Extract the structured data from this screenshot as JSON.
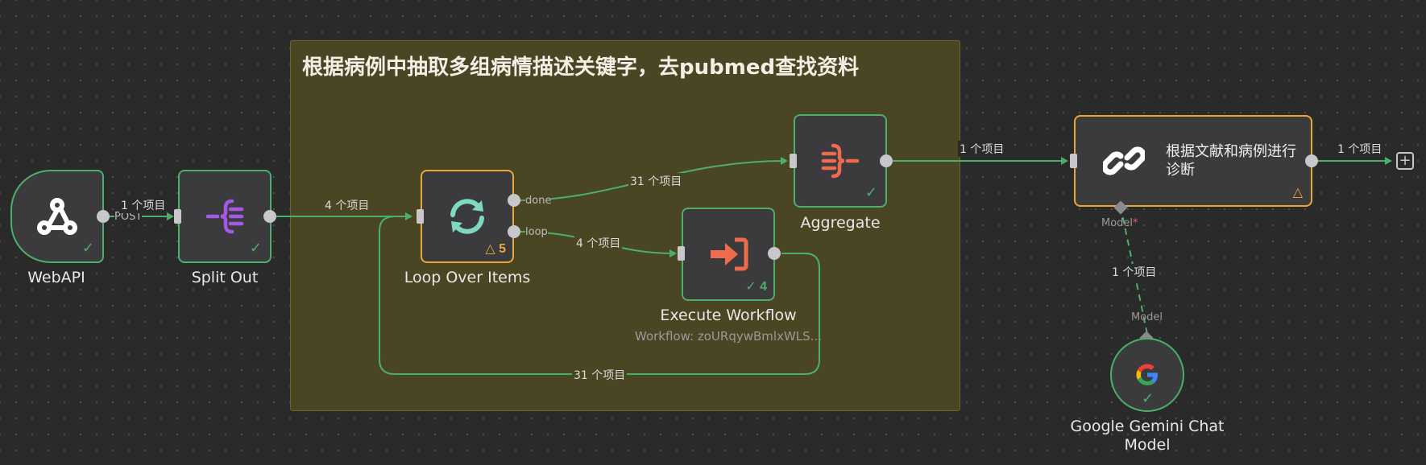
{
  "sticky_note": {
    "title": "根据病例中抽取多组病情描述关键字，去pubmed查找资料"
  },
  "nodes": {
    "webapi": {
      "label": "WebAPI",
      "output_name": "POST"
    },
    "split_out": {
      "label": "Split Out"
    },
    "loop": {
      "label": "Loop Over Items",
      "badge": "5",
      "out_done": "done",
      "out_loop": "loop"
    },
    "execute": {
      "label": "Execute Workflow",
      "subtitle": "Workflow: zoURqywBmlxWLS...",
      "badge": "4"
    },
    "aggregate": {
      "label": "Aggregate"
    },
    "diagnose": {
      "title": "根据文献和病例进行诊断",
      "model_input": "Model",
      "model_required": "*"
    },
    "gemini": {
      "label": "Google Gemini Chat Model",
      "model_output": "Model"
    }
  },
  "edges": {
    "webapi_split": "1 个项目",
    "split_loop": "4 个项目",
    "done_aggregate": "31 个项目",
    "loop_execute": "4 个项目",
    "execute_back": "31 个项目",
    "aggregate_diagnose": "1 个项目",
    "diagnose_out": "1 个项目",
    "gemini_diagnose": "1 个项目"
  },
  "colors": {
    "success": "#4caf6a",
    "warning": "#e8a838",
    "sticky_bg": "#4a4522",
    "canvas_bg": "#2a2a2b"
  },
  "icons": {
    "webapi": "webhook-icon",
    "split_out": "split-out-icon",
    "loop": "loop-arrows-icon",
    "execute": "execute-workflow-icon",
    "aggregate": "aggregate-icon",
    "diagnose": "link-chain-icon",
    "gemini": "google-g-icon",
    "add": "plus-icon"
  }
}
